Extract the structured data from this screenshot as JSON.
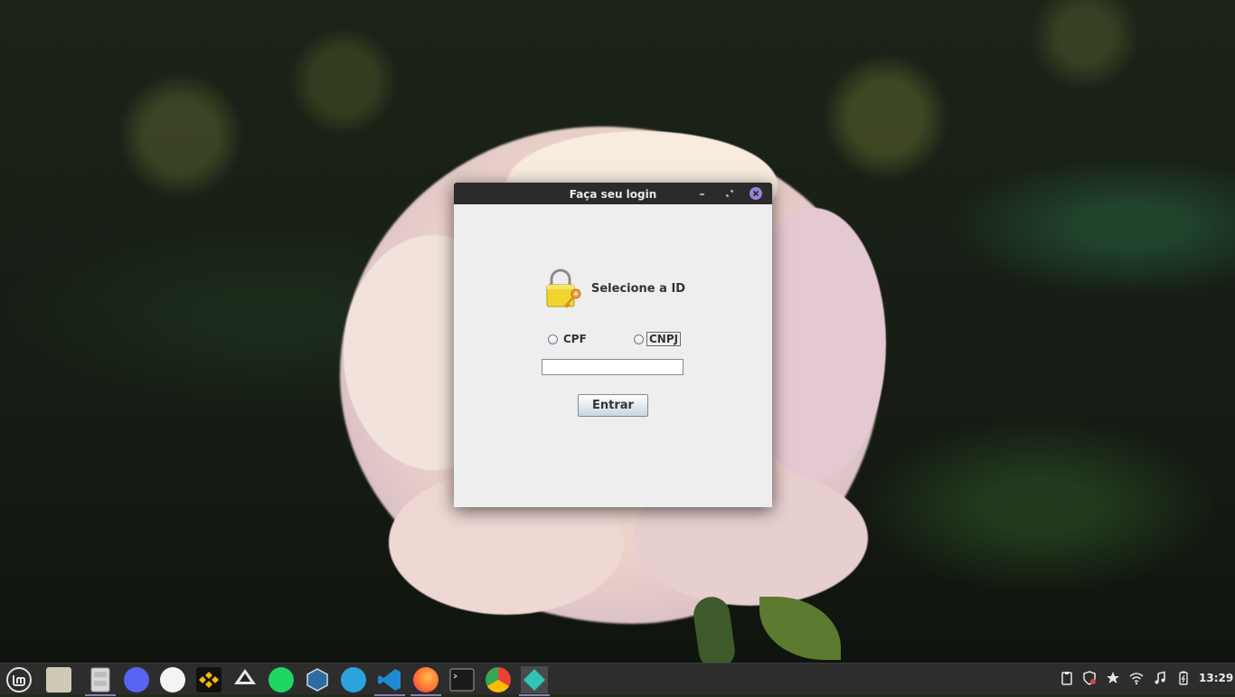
{
  "window": {
    "title": "Faça seu login",
    "heading": "Selecione a ID",
    "radio_cpf_label": "CPF",
    "radio_cnpj_label": "CNPJ",
    "id_input_value": "",
    "submit_label": "Entrar"
  },
  "taskbar": {
    "clock": "13:29",
    "apps": [
      "linux-mint-menu-icon",
      "files-folder-icon",
      "file-cabinet-icon",
      "discord-icon",
      "android-studio-icon",
      "binance-icon",
      "inkscape-icon",
      "spotify-icon",
      "virtualbox-icon",
      "telegram-icon",
      "vscode-icon",
      "firefox-icon",
      "terminal-icon",
      "chrome-icon",
      "java-app-icon"
    ],
    "tray": [
      "clipboard-icon",
      "shield-icon",
      "star-icon",
      "wifi-icon",
      "music-icon",
      "battery-icon"
    ]
  },
  "colors": {
    "titlebar": "#2b2b2b",
    "close_button": "#9b82d6",
    "window_bg": "#eeeeee",
    "taskbar": "#2d2d2d",
    "active_indicator": "#8e7cc3"
  }
}
